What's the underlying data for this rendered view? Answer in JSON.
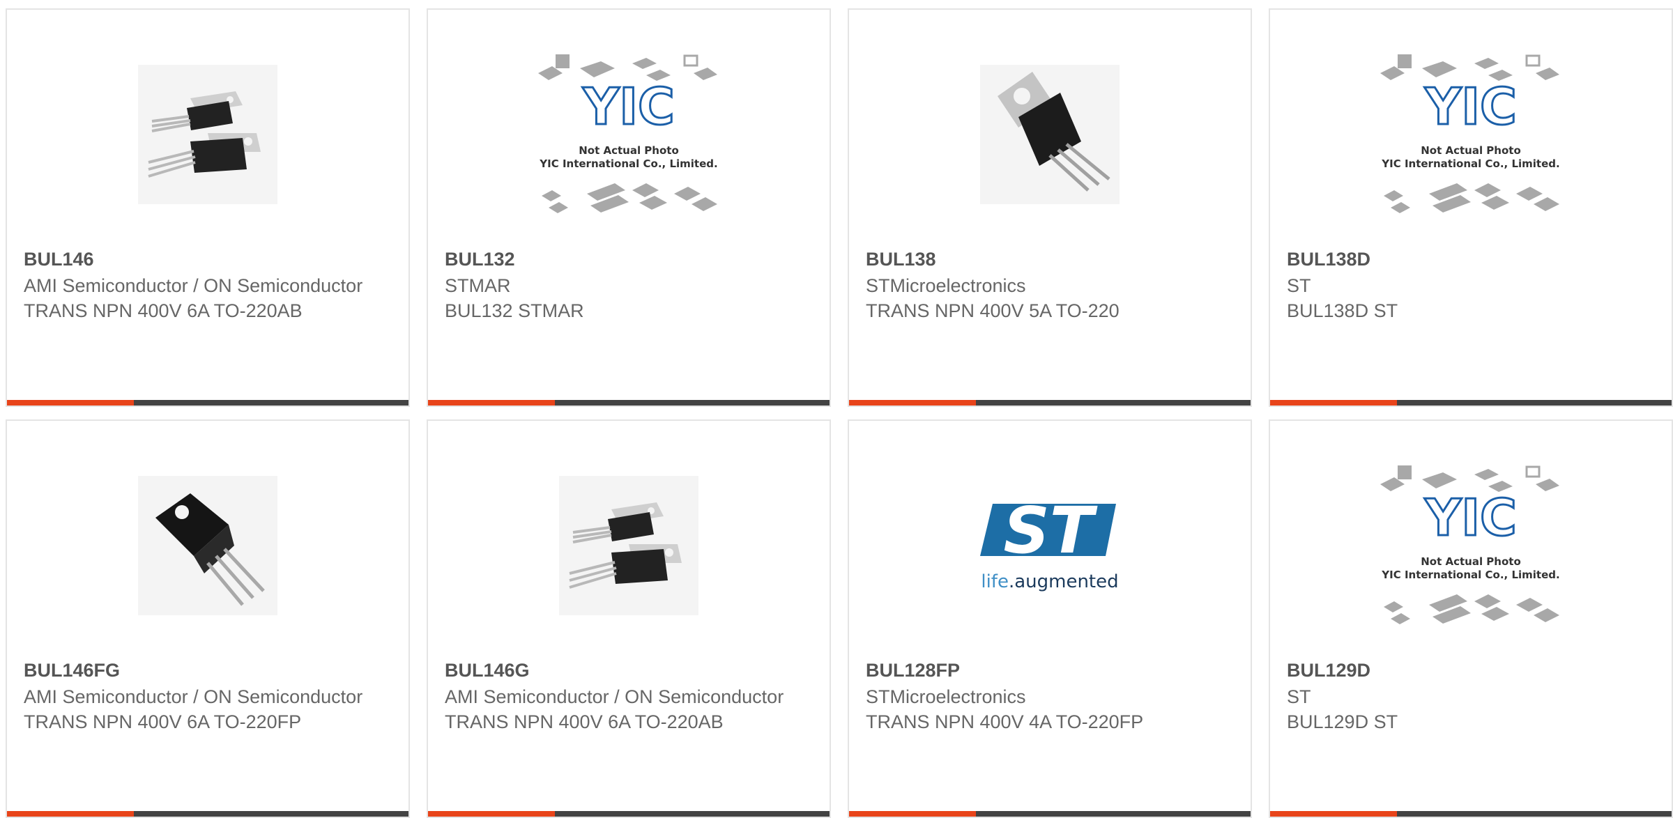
{
  "colors": {
    "accent": "#e8441a",
    "bar": "#434343",
    "text": "#666666",
    "st_blue": "#1d6ea6"
  },
  "products": [
    {
      "part_number": "BUL146",
      "manufacturer": "AMI Semiconductor / ON Semiconductor",
      "description": "TRANS NPN 400V 6A TO-220AB",
      "image": "two-to220-transistors-photo"
    },
    {
      "part_number": "BUL132",
      "manufacturer": "STMAR",
      "description": "BUL132 STMAR",
      "image": "yic-placeholder-photo"
    },
    {
      "part_number": "BUL138",
      "manufacturer": "STMicroelectronics",
      "description": "TRANS NPN 400V 5A TO-220",
      "image": "single-to220-transistor-photo"
    },
    {
      "part_number": "BUL138D",
      "manufacturer": "ST",
      "description": "BUL138D ST",
      "image": "yic-placeholder-photo"
    },
    {
      "part_number": "BUL146FG",
      "manufacturer": "AMI Semiconductor / ON Semiconductor",
      "description": "TRANS NPN 400V 6A TO-220FP",
      "image": "to220fp-transistor-photo"
    },
    {
      "part_number": "BUL146G",
      "manufacturer": "AMI Semiconductor / ON Semiconductor",
      "description": "TRANS NPN 400V 6A TO-220AB",
      "image": "two-to220-transistors-photo"
    },
    {
      "part_number": "BUL128FP",
      "manufacturer": "STMicroelectronics",
      "description": "TRANS NPN 400V 4A TO-220FP",
      "image": "st-logo"
    },
    {
      "part_number": "BUL129D",
      "manufacturer": "ST",
      "description": "BUL129D ST",
      "image": "yic-placeholder-photo"
    }
  ],
  "placeholder": {
    "brand": "YIC",
    "caption_line1": "Not Actual Photo",
    "caption_line2": "YIC International Co., Limited."
  },
  "st_logo": {
    "mark": "ST",
    "tagline_part1": "life",
    "tagline_part2": ".augmented"
  }
}
